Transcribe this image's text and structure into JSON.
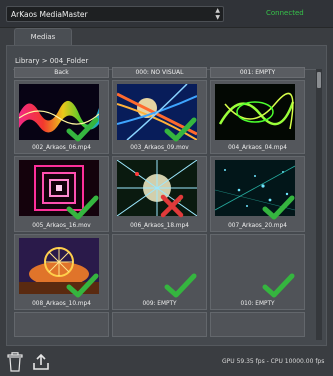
{
  "header": {
    "device_name": "ArKaos MediaMaster",
    "status": "Connected",
    "status_color": "#36c24a"
  },
  "tabs": [
    {
      "label": "Medias"
    }
  ],
  "breadcrumb": "Library > 004_Folder",
  "header_row": [
    {
      "label": "Back"
    },
    {
      "label": "000: NO VISUAL"
    },
    {
      "label": "001: EMPTY"
    }
  ],
  "media": [
    {
      "name": "002_Arkaos_06.mp4",
      "status": "check"
    },
    {
      "name": "003_Arkaos_09.mov",
      "status": "check"
    },
    {
      "name": "004_Arkaos_04.mp4",
      "status": "none"
    },
    {
      "name": "005_Arkaos_16.mov",
      "status": "check"
    },
    {
      "name": "006_Arkaos_18.mp4",
      "status": "error"
    },
    {
      "name": "007_Arkaos_20.mp4",
      "status": "check"
    },
    {
      "name": "008_Arkaos_10.mp4",
      "status": "check"
    },
    {
      "name": "009: EMPTY",
      "status": "check"
    },
    {
      "name": "010: EMPTY",
      "status": "check"
    }
  ],
  "footer": {
    "stats": "GPU  59.35 fps - CPU 10000.00 fps"
  },
  "colors": {
    "check": "#35b53f",
    "error": "#e03a3a"
  },
  "icons": {
    "trash": "trash-icon",
    "export": "export-icon",
    "dropdown": "chevron-updown-icon",
    "scroll": "scrollbar"
  }
}
